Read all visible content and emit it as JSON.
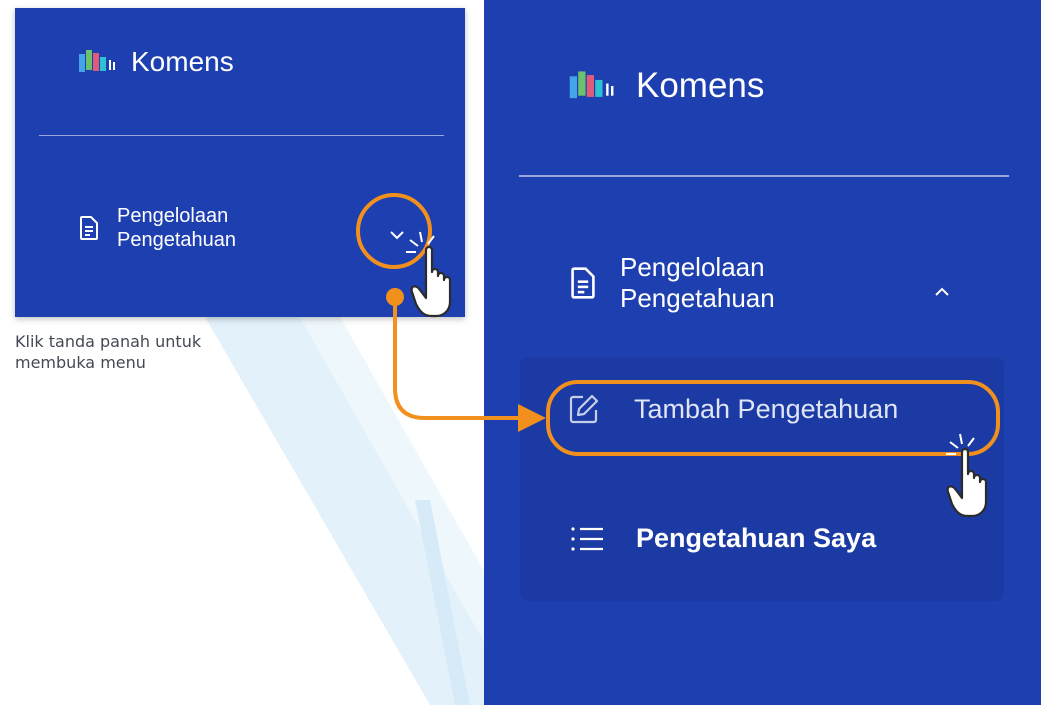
{
  "colors": {
    "panel_bg": "#1e3fb0",
    "submenu_bg": "#1b3aa3",
    "highlight": "#f2901e",
    "stripe_light": "#e3f1fa"
  },
  "screen_before": {
    "brand": {
      "name": "Komens",
      "logo_icon": "komens-logo-icon"
    },
    "menu": {
      "icon": "document-icon",
      "label_line1": "Pengelolaan",
      "label_line2": "Pengetahuan",
      "toggle_icon": "chevron-down-icon"
    },
    "pointer_icon": "hand-pointer-icon"
  },
  "screen_after": {
    "brand": {
      "name": "Komens",
      "logo_icon": "komens-logo-icon"
    },
    "menu": {
      "icon": "document-icon",
      "label_line1": "Pengelolaan",
      "label_line2": "Pengetahuan",
      "toggle_icon": "chevron-up-icon"
    },
    "submenu": [
      {
        "icon": "edit-icon",
        "label": "Tambah Pengetahuan"
      },
      {
        "icon": "list-icon",
        "label": "Pengetahuan Saya"
      }
    ],
    "pointer_icon": "hand-pointer-icon"
  },
  "caption": {
    "line1": "Klik tanda panah untuk",
    "line2": "membuka menu"
  }
}
